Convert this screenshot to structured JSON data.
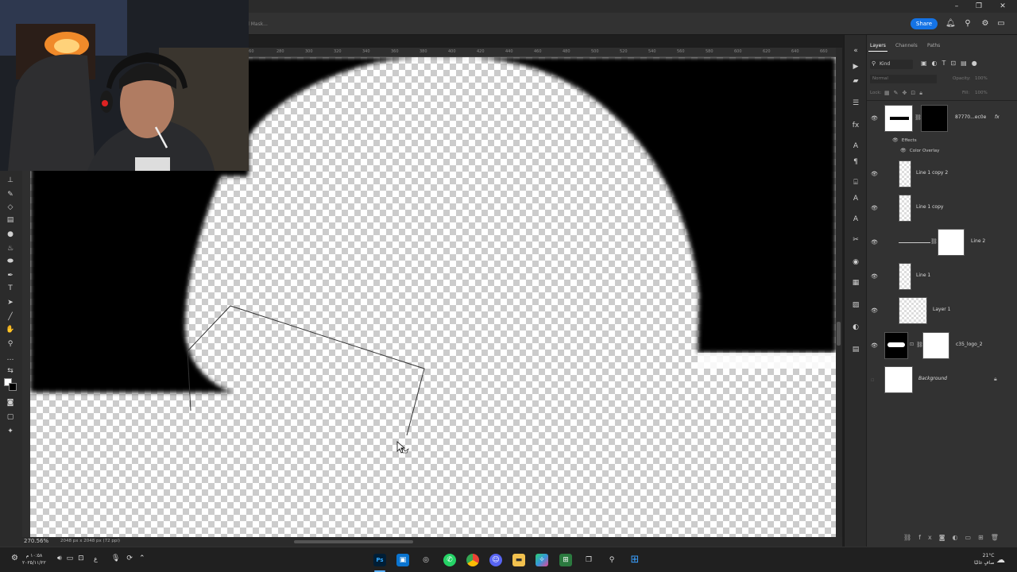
{
  "window": {
    "share_label": "Share",
    "doc_tab_label": "d Mask..."
  },
  "ruler": {
    "ticks": [
      "260",
      "280",
      "300",
      "320",
      "340",
      "360",
      "380",
      "400",
      "420",
      "440",
      "460",
      "480",
      "500",
      "520",
      "540",
      "560",
      "580",
      "600",
      "620",
      "640",
      "660"
    ]
  },
  "status": {
    "zoom": "270.56%",
    "doc_info": "2048 px x 2048 px (72 ppi)"
  },
  "layers_panel": {
    "tabs": [
      "Layers",
      "Channels",
      "Paths"
    ],
    "filter_label": "Kind",
    "blend_mode": "Normal",
    "opacity_label": "Opacity:",
    "opacity_value": "100%",
    "lock_label": "Lock:",
    "fill_label": "Fill:",
    "fill_value": "100%",
    "layers": [
      {
        "name": "87770...ec0e",
        "fx": "fx"
      },
      {
        "name": "Effects"
      },
      {
        "name": "Color Overlay"
      },
      {
        "name": "Line 1 copy 2"
      },
      {
        "name": "Line 1 copy"
      },
      {
        "name": "Line 2"
      },
      {
        "name": "Line 1"
      },
      {
        "name": "Layer 1"
      },
      {
        "name": "c35_logo_2"
      },
      {
        "name": "Background"
      }
    ]
  },
  "taskbar": {
    "time": "١٠:٥٨ م",
    "date": "٢٠٢٥/١١/٢٢",
    "weather_temp": "21°C",
    "weather_desc": "صافٍ غالبًا",
    "lang": "ع"
  },
  "colors": {
    "accent": "#1473e6",
    "panel_bg": "#323232",
    "canvas_black": "#000000"
  }
}
